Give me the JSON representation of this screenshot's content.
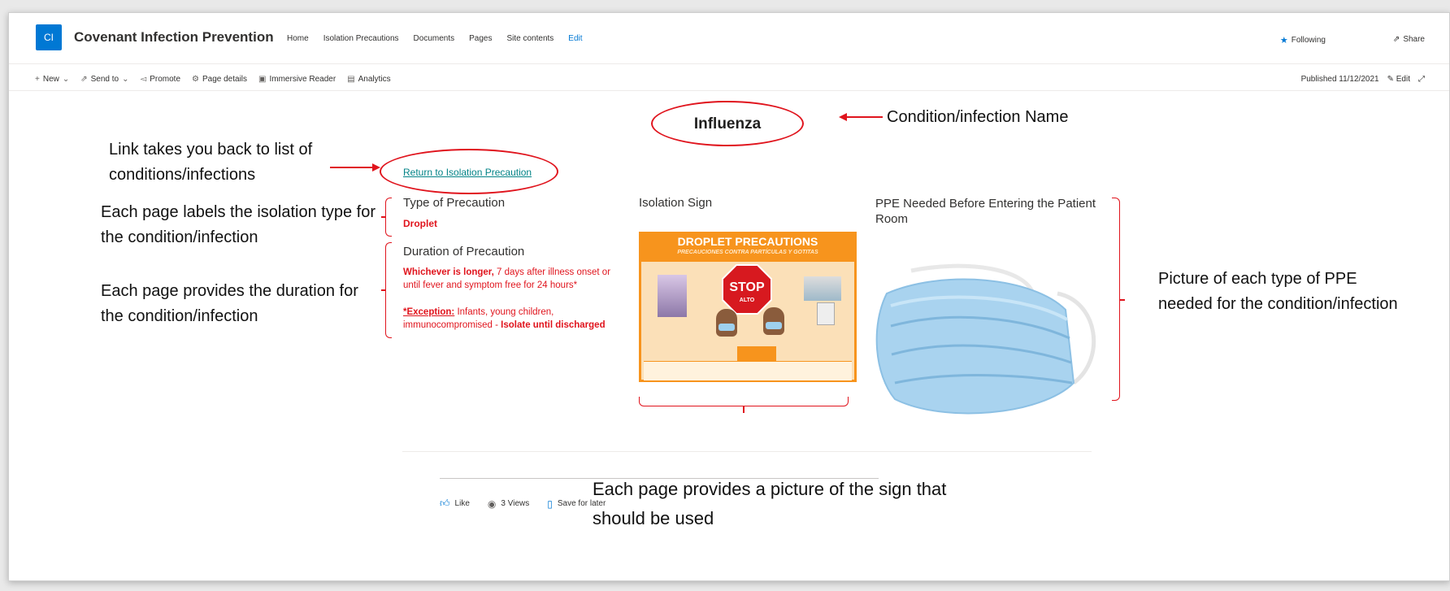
{
  "header": {
    "logo_text": "CI",
    "site_title": "Covenant Infection Prevention",
    "nav": [
      "Home",
      "Isolation Precautions",
      "Documents",
      "Pages",
      "Site contents",
      "Edit"
    ],
    "following": "Following",
    "share": "Share"
  },
  "commandbar": {
    "new": "New",
    "send_to": "Send to",
    "promote": "Promote",
    "page_details": "Page details",
    "immersive_reader": "Immersive Reader",
    "analytics": "Analytics",
    "published": "Published 11/12/2021",
    "edit": "Edit"
  },
  "page": {
    "title": "Influenza",
    "return_link": "Return to Isolation Precaution",
    "type_heading": "Type of Precaution",
    "type_value": "Droplet",
    "duration_heading": "Duration of Precaution",
    "duration_bold": "Whichever is longer,",
    "duration_text": " 7 days after illness onset or until fever and symptom free for 24 hours*",
    "exception_label": "*Exception:",
    "exception_text": " Infants, young children, immunocompromised - ",
    "exception_bold": "Isolate until discharged",
    "sign_heading": "Isolation Sign",
    "ppe_heading": "PPE Needed Before Entering the Patient Room"
  },
  "sign": {
    "title": "DROPLET PRECAUTIONS",
    "subtitle": "PRECAUCIONES CONTRA PARTÍCULAS Y GOTITAS",
    "stop": "STOP",
    "alto": "ALTO"
  },
  "annotations": {
    "title_name": "Condition/infection Name",
    "link": "Link takes you back to list of conditions/infections",
    "type": "Each page labels the isolation type for the condition/infection",
    "duration": "Each page provides the duration for the condition/infection",
    "ppe": "Picture of each type of PPE needed for the condition/infection",
    "sign": "Each page provides a picture of the sign that should be used"
  },
  "footer": {
    "like": "Like",
    "views": "3 Views",
    "save": "Save for later"
  },
  "colors": {
    "accent": "#0078d4",
    "annotation_red": "#e0141d",
    "sign_orange": "#f7941d",
    "link_teal": "#038387"
  }
}
